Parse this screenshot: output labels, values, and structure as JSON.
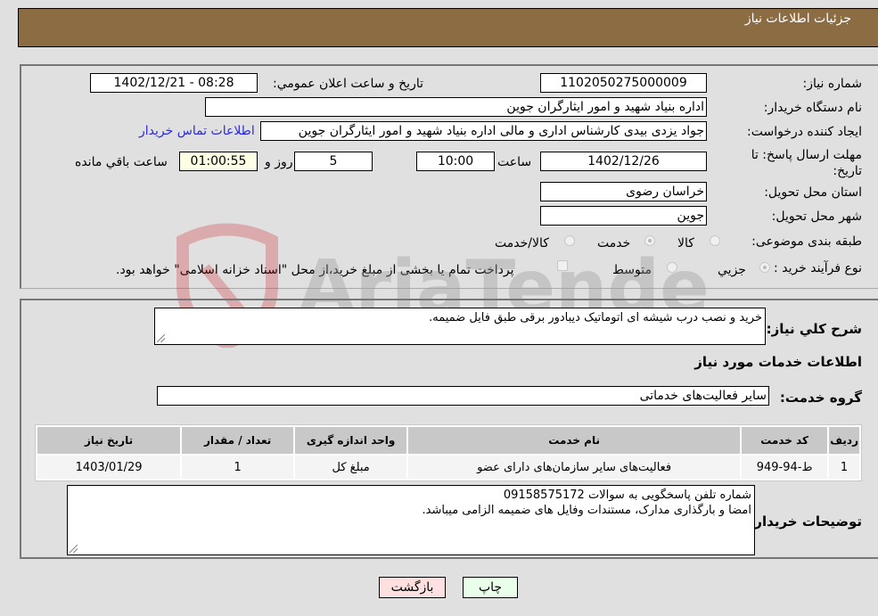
{
  "header": {
    "title": "جزئيات اطلاعات نياز"
  },
  "fields": {
    "need_number": {
      "label": "شماره نياز:",
      "value": "1102050275000009"
    },
    "announce_datetime": {
      "label": "تاريخ و ساعت اعلان عمومي:",
      "value": "1402/12/21 - 08:28"
    },
    "buyer_org": {
      "label": "نام دستگاه خريدار:",
      "value": "اداره بنیاد شهید و امور ایثارگران جوین"
    },
    "requester": {
      "label": "ايجاد كننده درخواست:",
      "value": "جواد یزدی بیدی کارشناس اداری و مالی اداره بنیاد شهید و امور ایثارگران جوین"
    },
    "buyer_contact_link": "اطلاعات تماس خريدار",
    "deadline": {
      "label": "مهلت ارسال پاسخ: تا تاريخ:",
      "date": "1402/12/26",
      "time_label": "ساعت",
      "time": "10:00",
      "days": "5",
      "days_label": "روز و",
      "remaining": "01:00:55",
      "remaining_label": "ساعت باقي مانده"
    },
    "province": {
      "label": "استان محل تحويل:",
      "value": "خراسان رضوی"
    },
    "city": {
      "label": "شهر محل تحويل:",
      "value": "جوین"
    },
    "category": {
      "label": "طبقه بندی موضوعی:",
      "options": [
        "کالا",
        "خدمت",
        "کالا/خدمت"
      ],
      "selected": "خدمت"
    },
    "process_type": {
      "label": "نوع فرآيند خريد :",
      "options": [
        "جزيي",
        "متوسط"
      ],
      "selected": "جزيي",
      "treasury_note": "پرداخت تمام یا بخشی از مبلغ خرید،از محل \"اسناد خزانه اسلامی\" خواهد بود."
    }
  },
  "description": {
    "label": "شرح كلي نياز:",
    "value": "خرید و نصب درب شیشه ای اتوماتیک دیبادور برقی طبق فایل ضمیمه."
  },
  "services_section_title": "اطلاعات خدمات مورد نياز",
  "service_group": {
    "label": "گروه خدمت:",
    "value": "سایر فعالیت‌های خدماتی"
  },
  "table": {
    "headers": [
      "رديف",
      "كد خدمت",
      "نام خدمت",
      "واحد اندازه گيری",
      "تعداد / مقدار",
      "تاريخ نياز"
    ],
    "rows": [
      [
        "1",
        "ط-94-949",
        "فعالیت‌های سایر سازمان‌های دارای عضو",
        "مبلغ کل",
        "1",
        "1403/01/29"
      ]
    ]
  },
  "buyer_notes": {
    "label": "توضيحات خريدار:",
    "line1": "شماره تلفن پاسخگویی به سوالات 09158575172",
    "line2": "امضا و بارگذاری مدارک، مستندات وفایل های ضمیمه الزامی میباشد."
  },
  "buttons": {
    "print": "چاپ",
    "back": "بازگشت"
  },
  "watermark": {
    "text": "AriaTender.neT"
  }
}
